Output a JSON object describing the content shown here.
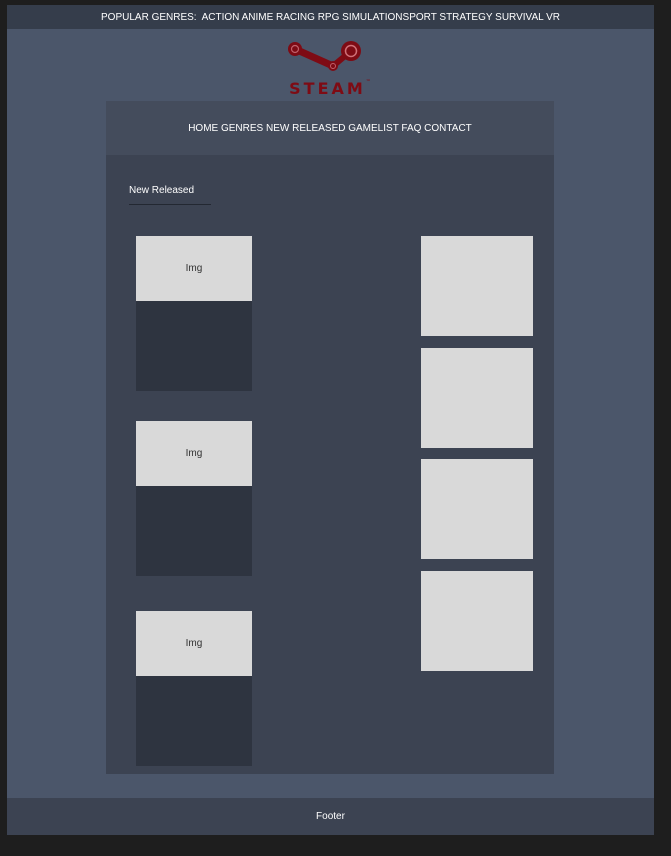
{
  "topbar": {
    "text": "POPULAR GENRES:  ACTION ANIME RACING RPG SIMULATIONSPORT STRATEGY SURVIVAL VR"
  },
  "logo": {
    "text": "STEAM",
    "tm": "™",
    "color": "#7e0b14"
  },
  "nav": {
    "text": "HOME GENRES NEW RELEASED GAMELIST FAQ CONTACT"
  },
  "section": {
    "title": "New Released"
  },
  "cards": [
    {
      "img_label": "Img"
    },
    {
      "img_label": "Img"
    },
    {
      "img_label": "Img"
    }
  ],
  "footer": {
    "text": "Footer"
  },
  "colors": {
    "page_background": "#4b566a",
    "topbar": "#353d4b",
    "main_panel": "#3c4352",
    "navbar": "#444c5c",
    "card_body": "#2e3440",
    "placeholder": "#d9d9d9"
  }
}
